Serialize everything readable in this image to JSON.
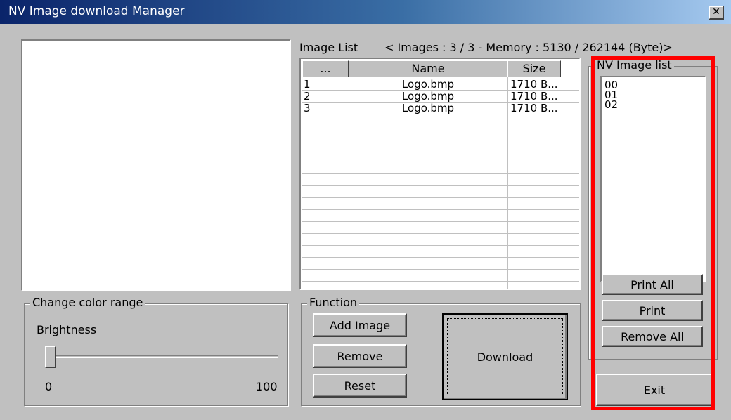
{
  "window": {
    "title": "NV Image download Manager",
    "close_glyph": "✕"
  },
  "image_list": {
    "label": "Image List",
    "summary": "< Images : 3 / 3 - Memory : 5130 / 262144 (Byte)>",
    "columns": [
      "...",
      "Name",
      "Size"
    ],
    "rows": [
      {
        "index": "1",
        "name": "Logo.bmp",
        "size": "1710 B..."
      },
      {
        "index": "2",
        "name": "Logo.bmp",
        "size": "1710 B..."
      },
      {
        "index": "3",
        "name": "Logo.bmp",
        "size": "1710 B..."
      }
    ]
  },
  "nv_image_list": {
    "label": "NV Image list",
    "items": [
      "00",
      "01",
      "02"
    ],
    "print_all": "Print All",
    "print": "Print",
    "remove_all": "Remove All"
  },
  "color_range": {
    "label": "Change color range",
    "brightness_label": "Brightness",
    "min_label": "0",
    "max_label": "100",
    "value": 0
  },
  "function": {
    "label": "Function",
    "add_image": "Add Image",
    "remove": "Remove",
    "reset": "Reset",
    "download": "Download"
  },
  "exit_label": "Exit",
  "colors": {
    "highlight": "#ff0000",
    "face": "#c0c0c0",
    "title_start": "#0a246a"
  }
}
